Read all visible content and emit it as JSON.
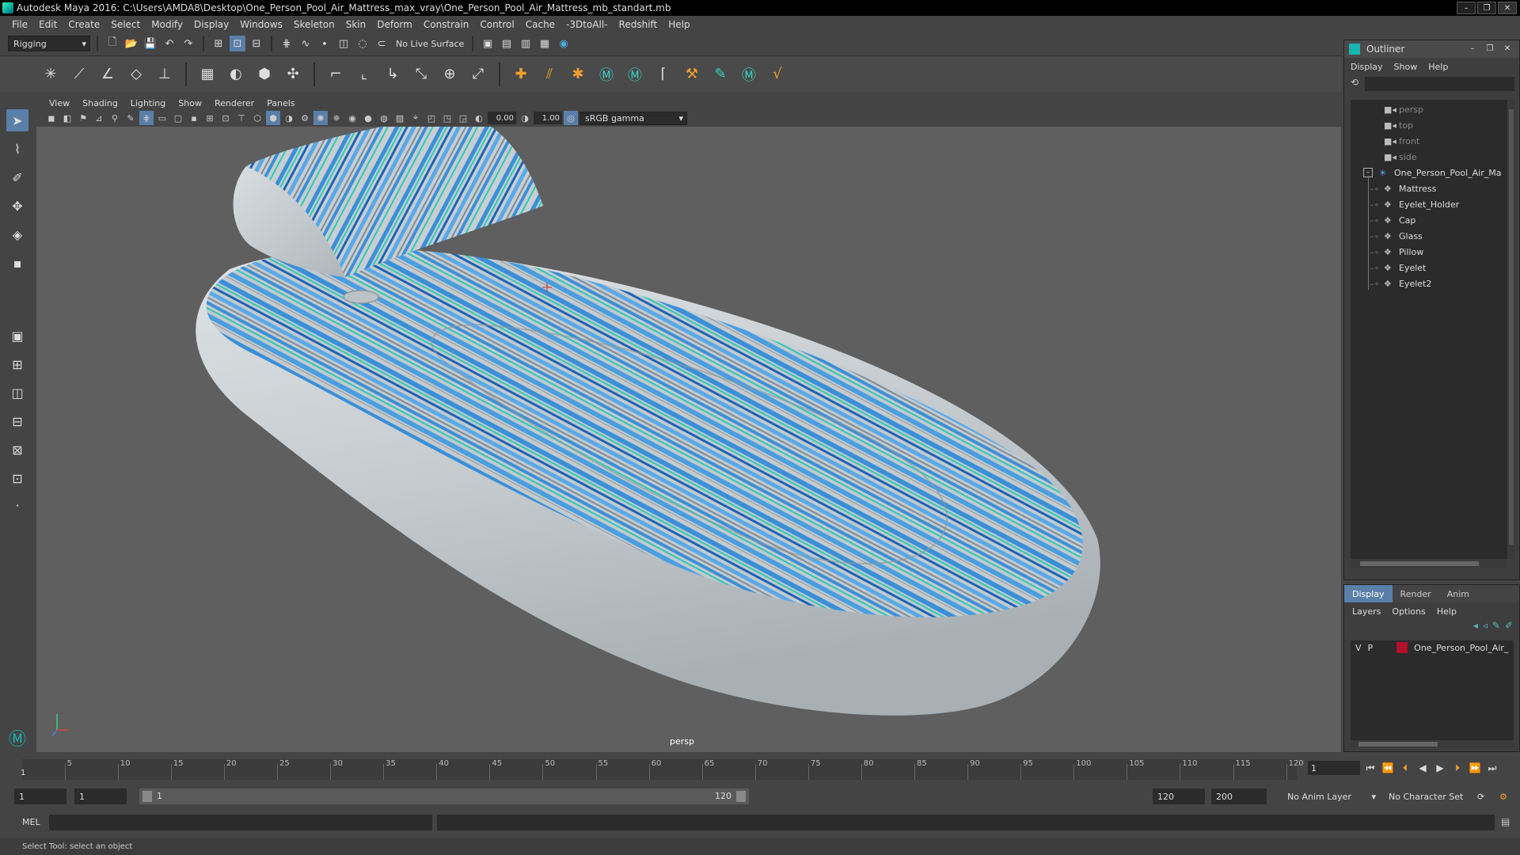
{
  "window": {
    "title": "Autodesk Maya 2016: C:\\Users\\AMDA8\\Desktop\\One_Person_Pool_Air_Mattress_max_vray\\One_Person_Pool_Air_Mattress_mb_standart.mb"
  },
  "menubar": [
    "File",
    "Edit",
    "Create",
    "Select",
    "Modify",
    "Display",
    "Windows",
    "Skeleton",
    "Skin",
    "Deform",
    "Constrain",
    "Control",
    "Cache",
    "-3DtoAll-",
    "Redshift",
    "Help"
  ],
  "statusline": {
    "mode": "Rigging",
    "live_surface": "No Live Surface"
  },
  "viewport": {
    "menu": [
      "View",
      "Shading",
      "Lighting",
      "Show",
      "Renderer",
      "Panels"
    ],
    "exposure": "0.00",
    "gamma": "1.00",
    "color_space": "sRGB gamma",
    "camera_label": "persp"
  },
  "outliner": {
    "title": "Outliner",
    "menu": [
      "Display",
      "Show",
      "Help"
    ],
    "cameras": [
      "persp",
      "top",
      "front",
      "side"
    ],
    "group": "One_Person_Pool_Air_Ma",
    "children": [
      "Mattress",
      "Eyelet_Holder",
      "Cap",
      "Glass",
      "Pillow",
      "Eyelet",
      "Eyelet2"
    ]
  },
  "layer_editor": {
    "tabs": [
      "Display",
      "Render",
      "Anim"
    ],
    "menu": [
      "Layers",
      "Options",
      "Help"
    ],
    "layer": {
      "v": "V",
      "p": "P",
      "name": "One_Person_Pool_Air_",
      "color": "#b0102a"
    }
  },
  "timeline": {
    "ticks": [
      5,
      10,
      15,
      20,
      25,
      30,
      35,
      40,
      45,
      50,
      55,
      60,
      65,
      70,
      75,
      80,
      85,
      90,
      95,
      100,
      105,
      110,
      115,
      120
    ],
    "start_mark": "1",
    "current_frame": "1"
  },
  "range": {
    "start": "1",
    "playback_start": "1",
    "bar_start": "1",
    "bar_end": "120",
    "playback_end": "120",
    "end": "200",
    "anim_layer": "No Anim Layer",
    "character_set": "No Character Set"
  },
  "cmdline": {
    "label": "MEL"
  },
  "helpline": {
    "text": "Select Tool: select an object"
  },
  "colors": {
    "accent": "#5a7fa8",
    "stripe_blue": "#3a8fd8",
    "stripe_teal": "#2ec8b8",
    "body": "#c6ccd0"
  }
}
